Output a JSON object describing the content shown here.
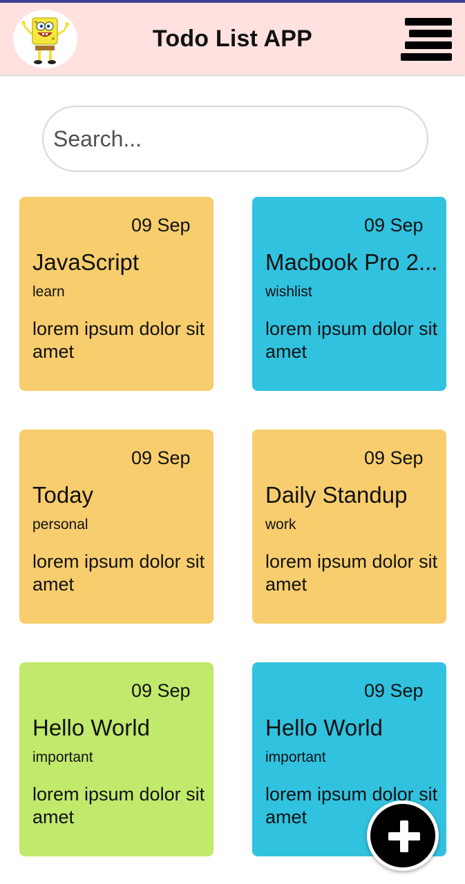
{
  "app": {
    "title": "Todo List APP",
    "avatar_icon": "spongebob-avatar-icon",
    "menu_icon": "hamburger-menu-icon"
  },
  "search": {
    "placeholder": "Search..."
  },
  "colors": {
    "header_bg": "#ffe1df",
    "orange": "#f8cd6d",
    "cyan": "#31c2df",
    "green": "#c1e96c",
    "fab": "#000000"
  },
  "notes": [
    {
      "date": "09 Sep",
      "title": "JavaScript",
      "category": "learn",
      "description": "lorem ipsum dolor sit amet",
      "color": "#f8cd6d"
    },
    {
      "date": "09 Sep",
      "title": "Macbook Pro 2...",
      "category": "wishlist",
      "description": "lorem ipsum dolor sit amet",
      "color": "#31c2df"
    },
    {
      "date": "09 Sep",
      "title": "Today",
      "category": "personal",
      "description": "lorem ipsum dolor sit amet",
      "color": "#f8cd6d"
    },
    {
      "date": "09 Sep",
      "title": "Daily Standup",
      "category": "work",
      "description": "lorem ipsum dolor sit amet",
      "color": "#f8cd6d"
    },
    {
      "date": "09 Sep",
      "title": "Hello World",
      "category": "important",
      "description": "lorem ipsum dolor sit amet",
      "color": "#c1e96c"
    },
    {
      "date": "09 Sep",
      "title": "Hello World",
      "category": "important",
      "description": "lorem ipsum dolor sit amet",
      "color": "#31c2df"
    }
  ],
  "fab": {
    "icon": "plus-icon"
  }
}
